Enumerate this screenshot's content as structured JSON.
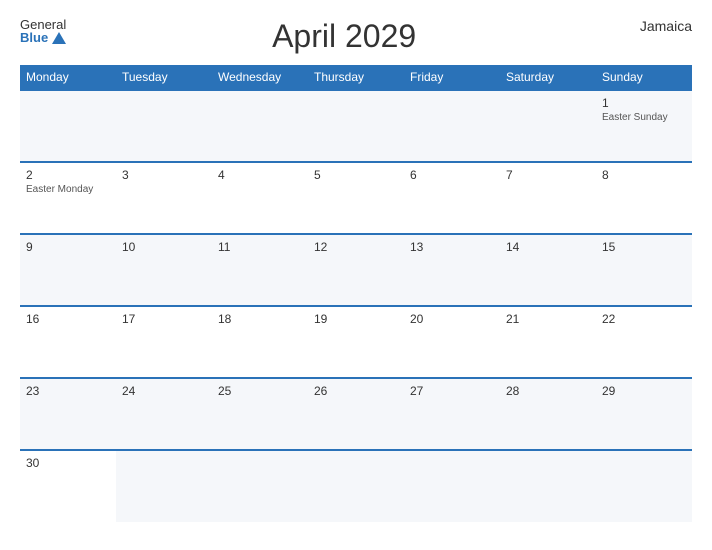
{
  "header": {
    "logo_general": "General",
    "logo_blue": "Blue",
    "title": "April 2029",
    "country": "Jamaica"
  },
  "weekdays": [
    "Monday",
    "Tuesday",
    "Wednesday",
    "Thursday",
    "Friday",
    "Saturday",
    "Sunday"
  ],
  "weeks": [
    [
      {
        "day": "",
        "holiday": ""
      },
      {
        "day": "",
        "holiday": ""
      },
      {
        "day": "",
        "holiday": ""
      },
      {
        "day": "",
        "holiday": ""
      },
      {
        "day": "",
        "holiday": ""
      },
      {
        "day": "",
        "holiday": ""
      },
      {
        "day": "1",
        "holiday": "Easter Sunday"
      }
    ],
    [
      {
        "day": "2",
        "holiday": "Easter Monday"
      },
      {
        "day": "3",
        "holiday": ""
      },
      {
        "day": "4",
        "holiday": ""
      },
      {
        "day": "5",
        "holiday": ""
      },
      {
        "day": "6",
        "holiday": ""
      },
      {
        "day": "7",
        "holiday": ""
      },
      {
        "day": "8",
        "holiday": ""
      }
    ],
    [
      {
        "day": "9",
        "holiday": ""
      },
      {
        "day": "10",
        "holiday": ""
      },
      {
        "day": "11",
        "holiday": ""
      },
      {
        "day": "12",
        "holiday": ""
      },
      {
        "day": "13",
        "holiday": ""
      },
      {
        "day": "14",
        "holiday": ""
      },
      {
        "day": "15",
        "holiday": ""
      }
    ],
    [
      {
        "day": "16",
        "holiday": ""
      },
      {
        "day": "17",
        "holiday": ""
      },
      {
        "day": "18",
        "holiday": ""
      },
      {
        "day": "19",
        "holiday": ""
      },
      {
        "day": "20",
        "holiday": ""
      },
      {
        "day": "21",
        "holiday": ""
      },
      {
        "day": "22",
        "holiday": ""
      }
    ],
    [
      {
        "day": "23",
        "holiday": ""
      },
      {
        "day": "24",
        "holiday": ""
      },
      {
        "day": "25",
        "holiday": ""
      },
      {
        "day": "26",
        "holiday": ""
      },
      {
        "day": "27",
        "holiday": ""
      },
      {
        "day": "28",
        "holiday": ""
      },
      {
        "day": "29",
        "holiday": ""
      }
    ],
    [
      {
        "day": "30",
        "holiday": ""
      },
      {
        "day": "",
        "holiday": ""
      },
      {
        "day": "",
        "holiday": ""
      },
      {
        "day": "",
        "holiday": ""
      },
      {
        "day": "",
        "holiday": ""
      },
      {
        "day": "",
        "holiday": ""
      },
      {
        "day": "",
        "holiday": ""
      }
    ]
  ]
}
